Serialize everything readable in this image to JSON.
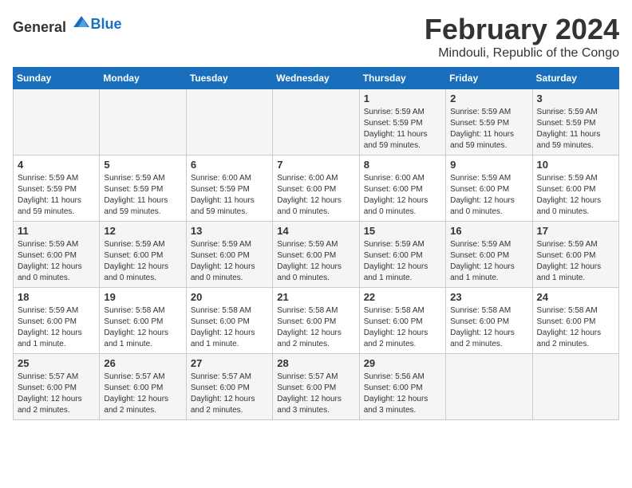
{
  "header": {
    "logo_general": "General",
    "logo_blue": "Blue",
    "month_year": "February 2024",
    "location": "Mindouli, Republic of the Congo"
  },
  "days_of_week": [
    "Sunday",
    "Monday",
    "Tuesday",
    "Wednesday",
    "Thursday",
    "Friday",
    "Saturday"
  ],
  "weeks": [
    [
      {
        "day": "",
        "content": ""
      },
      {
        "day": "",
        "content": ""
      },
      {
        "day": "",
        "content": ""
      },
      {
        "day": "",
        "content": ""
      },
      {
        "day": "1",
        "content": "Sunrise: 5:59 AM\nSunset: 5:59 PM\nDaylight: 11 hours\nand 59 minutes."
      },
      {
        "day": "2",
        "content": "Sunrise: 5:59 AM\nSunset: 5:59 PM\nDaylight: 11 hours\nand 59 minutes."
      },
      {
        "day": "3",
        "content": "Sunrise: 5:59 AM\nSunset: 5:59 PM\nDaylight: 11 hours\nand 59 minutes."
      }
    ],
    [
      {
        "day": "4",
        "content": "Sunrise: 5:59 AM\nSunset: 5:59 PM\nDaylight: 11 hours\nand 59 minutes."
      },
      {
        "day": "5",
        "content": "Sunrise: 5:59 AM\nSunset: 5:59 PM\nDaylight: 11 hours\nand 59 minutes."
      },
      {
        "day": "6",
        "content": "Sunrise: 6:00 AM\nSunset: 5:59 PM\nDaylight: 11 hours\nand 59 minutes."
      },
      {
        "day": "7",
        "content": "Sunrise: 6:00 AM\nSunset: 6:00 PM\nDaylight: 12 hours\nand 0 minutes."
      },
      {
        "day": "8",
        "content": "Sunrise: 6:00 AM\nSunset: 6:00 PM\nDaylight: 12 hours\nand 0 minutes."
      },
      {
        "day": "9",
        "content": "Sunrise: 5:59 AM\nSunset: 6:00 PM\nDaylight: 12 hours\nand 0 minutes."
      },
      {
        "day": "10",
        "content": "Sunrise: 5:59 AM\nSunset: 6:00 PM\nDaylight: 12 hours\nand 0 minutes."
      }
    ],
    [
      {
        "day": "11",
        "content": "Sunrise: 5:59 AM\nSunset: 6:00 PM\nDaylight: 12 hours\nand 0 minutes."
      },
      {
        "day": "12",
        "content": "Sunrise: 5:59 AM\nSunset: 6:00 PM\nDaylight: 12 hours\nand 0 minutes."
      },
      {
        "day": "13",
        "content": "Sunrise: 5:59 AM\nSunset: 6:00 PM\nDaylight: 12 hours\nand 0 minutes."
      },
      {
        "day": "14",
        "content": "Sunrise: 5:59 AM\nSunset: 6:00 PM\nDaylight: 12 hours\nand 0 minutes."
      },
      {
        "day": "15",
        "content": "Sunrise: 5:59 AM\nSunset: 6:00 PM\nDaylight: 12 hours\nand 1 minute."
      },
      {
        "day": "16",
        "content": "Sunrise: 5:59 AM\nSunset: 6:00 PM\nDaylight: 12 hours\nand 1 minute."
      },
      {
        "day": "17",
        "content": "Sunrise: 5:59 AM\nSunset: 6:00 PM\nDaylight: 12 hours\nand 1 minute."
      }
    ],
    [
      {
        "day": "18",
        "content": "Sunrise: 5:59 AM\nSunset: 6:00 PM\nDaylight: 12 hours\nand 1 minute."
      },
      {
        "day": "19",
        "content": "Sunrise: 5:58 AM\nSunset: 6:00 PM\nDaylight: 12 hours\nand 1 minute."
      },
      {
        "day": "20",
        "content": "Sunrise: 5:58 AM\nSunset: 6:00 PM\nDaylight: 12 hours\nand 1 minute."
      },
      {
        "day": "21",
        "content": "Sunrise: 5:58 AM\nSunset: 6:00 PM\nDaylight: 12 hours\nand 2 minutes."
      },
      {
        "day": "22",
        "content": "Sunrise: 5:58 AM\nSunset: 6:00 PM\nDaylight: 12 hours\nand 2 minutes."
      },
      {
        "day": "23",
        "content": "Sunrise: 5:58 AM\nSunset: 6:00 PM\nDaylight: 12 hours\nand 2 minutes."
      },
      {
        "day": "24",
        "content": "Sunrise: 5:58 AM\nSunset: 6:00 PM\nDaylight: 12 hours\nand 2 minutes."
      }
    ],
    [
      {
        "day": "25",
        "content": "Sunrise: 5:57 AM\nSunset: 6:00 PM\nDaylight: 12 hours\nand 2 minutes."
      },
      {
        "day": "26",
        "content": "Sunrise: 5:57 AM\nSunset: 6:00 PM\nDaylight: 12 hours\nand 2 minutes."
      },
      {
        "day": "27",
        "content": "Sunrise: 5:57 AM\nSunset: 6:00 PM\nDaylight: 12 hours\nand 2 minutes."
      },
      {
        "day": "28",
        "content": "Sunrise: 5:57 AM\nSunset: 6:00 PM\nDaylight: 12 hours\nand 3 minutes."
      },
      {
        "day": "29",
        "content": "Sunrise: 5:56 AM\nSunset: 6:00 PM\nDaylight: 12 hours\nand 3 minutes."
      },
      {
        "day": "",
        "content": ""
      },
      {
        "day": "",
        "content": ""
      }
    ]
  ]
}
